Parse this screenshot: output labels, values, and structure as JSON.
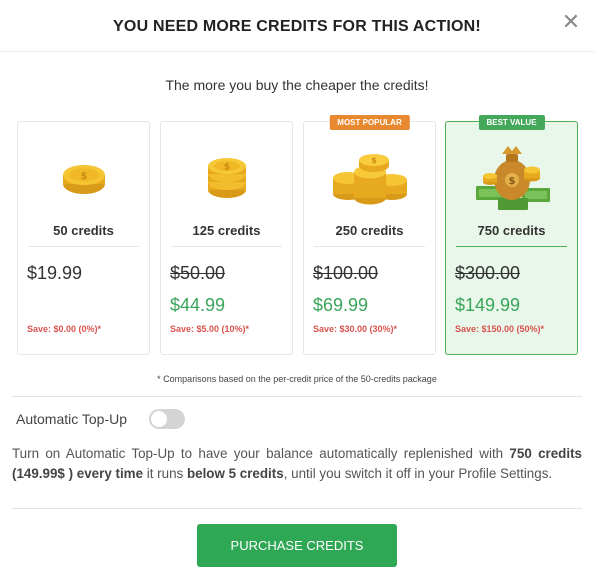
{
  "modal": {
    "title": "YOU NEED MORE CREDITS FOR THIS ACTION!",
    "close_glyph": "✕",
    "subtitle": "The more you buy the cheaper the credits!"
  },
  "packages": [
    {
      "credits": "50 credits",
      "price": "$19.99",
      "save": "Save: $0.00 (0%)*",
      "icon": "coin-icon"
    },
    {
      "credits": "125 credits",
      "old_price": "$50.00",
      "price": "$44.99",
      "save": "Save: $5.00 (10%)*",
      "icon": "coin-stack-icon"
    },
    {
      "credits": "250 credits",
      "old_price": "$100.00",
      "price": "$69.99",
      "save": "Save: $30.00 (30%)*",
      "badge": "MOST POPULAR",
      "icon": "coin-pile-icon"
    },
    {
      "credits": "750 credits",
      "old_price": "$300.00",
      "price": "$149.99",
      "save": "Save: $150.00 (50%)*",
      "badge": "BEST VALUE",
      "icon": "money-bag-icon"
    }
  ],
  "footnote": "* Comparisons based on the per-credit price of the 50-credits package",
  "topup": {
    "label": "Automatic Top-Up",
    "enabled": false,
    "desc_1": "Turn on Automatic Top-Up to have your balance automatically replenished with ",
    "desc_bold_1": "750 credits (149.99$ ) every time",
    "desc_2": " it runs ",
    "desc_bold_2": "below 5 credits",
    "desc_3": ", until you switch it off in your Profile Settings."
  },
  "purchase_label": "PURCHASE CREDITS",
  "colors": {
    "accent_green": "#2fa855",
    "price_green": "#3aa55a",
    "save_red": "#d9534f",
    "badge_orange": "#e8892f",
    "best_bg": "#e8f7ea"
  }
}
